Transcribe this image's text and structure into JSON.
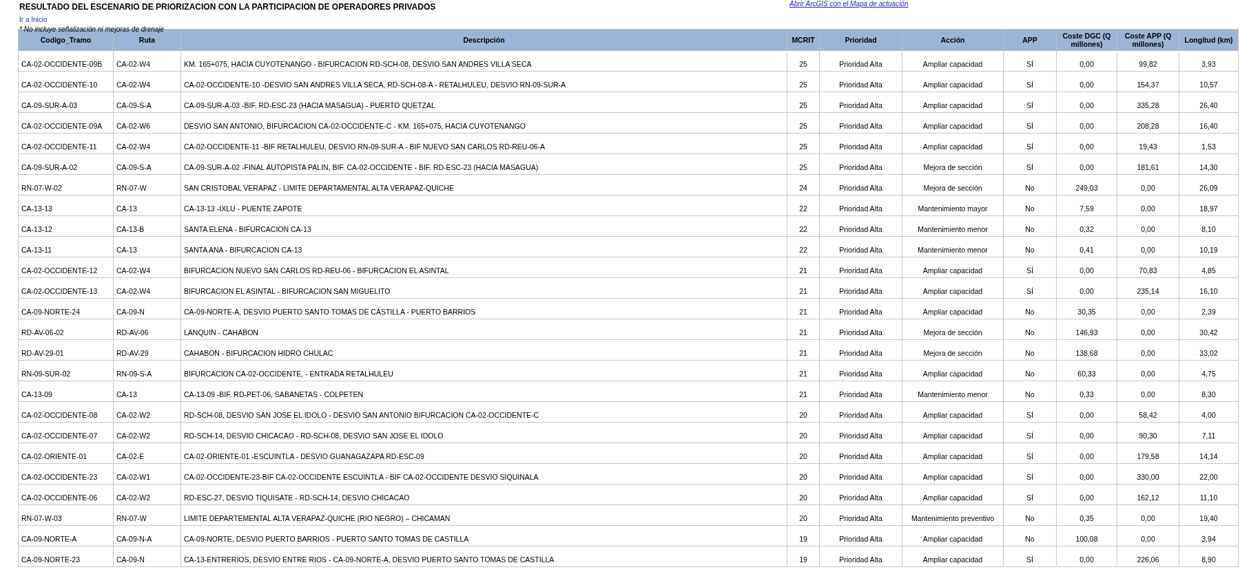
{
  "title": "RESULTADO DEL ESCENARIO DE PRIORIZACION CON LA PARTICIPACION DE OPERADORES PRIVADOS",
  "map_link": "Abrir ArcGIS con el Mapa de actuación",
  "home_link": "Ir a Inicio",
  "note": "* No incluye señalización ni mejoras de drenaje",
  "table": {
    "columns": [
      "Codigo_Tramo",
      "Ruta",
      "Descripción",
      "MCRIT",
      "Prioridad",
      "Acción",
      "APP",
      "Coste DGC (Q millones)",
      "Coste APP (Q millones)",
      "Longitud (km)"
    ],
    "rows": [
      [
        "CA-02-OCCIDENTE-09B",
        "CA-02-W4",
        "KM. 165+075, HACIA CUYOTENANGO - BIFURCACION RD-SCH-08, DESVIO SAN ANDRES VILLA SECA",
        "25",
        "Prioridad Alta",
        "Ampliar capacidad",
        "SÍ",
        "0,00",
        "99,82",
        "3,93"
      ],
      [
        "CA-02-OCCIDENTE-10",
        "CA-02-W4",
        "CA-02-OCCIDENTE-10 -DESVIO SAN ANDRES VILLA SECA, RD-SCH-08-A - RETALHULEU, DESVIO RN-09-SUR-A",
        "25",
        "Prioridad Alta",
        "Ampliar capacidad",
        "SÍ",
        "0,00",
        "154,37",
        "10,57"
      ],
      [
        "CA-09-SUR-A-03",
        "CA-09-S-A",
        "CA-09-SUR-A-03 -BIF. RD-ESC-23 (HACIA MASAGUA) - PUERTO QUETZAL",
        "25",
        "Prioridad Alta",
        "Ampliar capacidad",
        "SÍ",
        "0,00",
        "335,28",
        "26,40"
      ],
      [
        "CA-02-OCCIDENTE-09A",
        "CA-02-W6",
        "DESVIO SAN ANTONIO, BIFURCACION CA-02-OCCIDENTE-C - KM. 165+075, HACIA CUYOTENANGO",
        "25",
        "Prioridad Alta",
        "Ampliar capacidad",
        "SÍ",
        "0,00",
        "208,28",
        "16,40"
      ],
      [
        "CA-02-OCCIDENTE-11",
        "CA-02-W4",
        "CA-02-OCCIDENTE-11 -BIF RETALHULEU, DESVIO RN-09-SUR-A - BIF NUEVO SAN CARLOS RD-REU-06-A",
        "25",
        "Prioridad Alta",
        "Ampliar capacidad",
        "SÍ",
        "0,00",
        "19,43",
        "1,53"
      ],
      [
        "CA-09-SUR-A-02",
        "CA-09-S-A",
        "CA-09-SUR-A-02 -FINAL AUTOPISTA PALIN, BIF. CA-02-OCCIDENTE - BIF. RD-ESC-23 (HACIA MASAGUA)",
        "25",
        "Prioridad Alta",
        "Mejora de sección",
        "SÍ",
        "0,00",
        "181,61",
        "14,30"
      ],
      [
        "RN-07-W-02",
        "RN-07-W",
        "SAN CRISTOBAL VERAPAZ  - LIMITE DEPARTAMENTAL ALTA VERAPAZ-QUICHE",
        "24",
        "Prioridad Alta",
        "Mejora de sección",
        "No",
        "249,03",
        "0,00",
        "26,09"
      ],
      [
        "CA-13-13",
        "CA-13",
        "CA-13-13 -IXLU - PUENTE ZAPOTE",
        "22",
        "Prioridad Alta",
        "Mantenimiento mayor",
        "No",
        "7,59",
        "0,00",
        "18,97"
      ],
      [
        "CA-13-12",
        "CA-13-B",
        "SANTA ELENA - BIFURCACION CA-13",
        "22",
        "Prioridad Alta",
        "Mantenimiento menor",
        "No",
        "0,32",
        "0,00",
        "8,10"
      ],
      [
        "CA-13-11",
        "CA-13",
        "SANTA ANA - BIFURCACION CA-13",
        "22",
        "Prioridad Alta",
        "Mantenimiento menor",
        "No",
        "0,41",
        "0,00",
        "10,19"
      ],
      [
        "CA-02-OCCIDENTE-12",
        "CA-02-W4",
        "BIFURCACION NUEVO SAN CARLOS RD-REU-06 - BIFURCACION EL ASINTAL",
        "21",
        "Prioridad Alta",
        "Ampliar capacidad",
        "SÍ",
        "0,00",
        "70,83",
        "4,85"
      ],
      [
        "CA-02-OCCIDENTE-13",
        "CA-02-W4",
        "BIFURCACION EL ASINTAL - BIFURCACION SAN MIGUELITO",
        "21",
        "Prioridad Alta",
        "Ampliar capacidad",
        "SÍ",
        "0,00",
        "235,14",
        "16,10"
      ],
      [
        "CA-09-NORTE-24",
        "CA-09-N",
        "CA-09-NORTE-A, DESVIO PUERTO SANTO TOMAS DE CASTILLA - PUERTO BARRIOS",
        "21",
        "Prioridad Alta",
        "Ampliar capacidad",
        "No",
        "30,35",
        "0,00",
        "2,39"
      ],
      [
        "RD-AV-06-02",
        "RD-AV-06",
        "LANQUIN - CAHABON",
        "21",
        "Prioridad Alta",
        "Mejora de sección",
        "No",
        "146,93",
        "0,00",
        "30,42"
      ],
      [
        "RD-AV-29-01",
        "RD-AV-29",
        "CAHABON - BIFURCACION HIDRO CHULAC",
        "21",
        "Prioridad Alta",
        "Mejora de sección",
        "No",
        "138,68",
        "0,00",
        "33,02"
      ],
      [
        "RN-09-SUR-02",
        "RN-09-S-A",
        "BIFURCACION CA-02-OCCIDENTE, - ENTRADA RETALHULEU",
        "21",
        "Prioridad Alta",
        "Ampliar capacidad",
        "No",
        "60,33",
        "0,00",
        "4,75"
      ],
      [
        "CA-13-09",
        "CA-13",
        "CA-13-09 -BIF. RD-PET-06, SABANETAS - COLPETEN",
        "21",
        "Prioridad Alta",
        "Mantenimiento menor",
        "No",
        "0,33",
        "0,00",
        "8,30"
      ],
      [
        "CA-02-OCCIDENTE-08",
        "CA-02-W2",
        "RD-SCH-08, DESVIO SAN JOSE EL IDOLO - DESVIO SAN ANTONIO BIFURCACION CA-02-OCCIDENTE-C",
        "20",
        "Prioridad Alta",
        "Ampliar capacidad",
        "SÍ",
        "0,00",
        "58,42",
        "4,00"
      ],
      [
        "CA-02-OCCIDENTE-07",
        "CA-02-W2",
        "RD-SCH-14, DESVIO CHICACAO - RD-SCH-08, DESVIO SAN JOSE EL IDOLO",
        "20",
        "Prioridad Alta",
        "Ampliar capacidad",
        "SÍ",
        "0,00",
        "90,30",
        "7,11"
      ],
      [
        "CA-02-ORIENTE-01",
        "CA-02-E",
        "CA-02-ORIENTE-01 -ESCUINTLA - DESVIO GUANAGAZAPA RD-ESC-09",
        "20",
        "Prioridad Alta",
        "Ampliar capacidad",
        "SÍ",
        "0,00",
        "179,58",
        "14,14"
      ],
      [
        "CA-02-OCCIDENTE-23",
        "CA-02-W1",
        "CA-02-OCCIDENTE-23-BIF CA-02-OCCIDENTE ESCUINTLA -  BIF CA-02-OCCIDENTE DESVIO SIQUINALA",
        "20",
        "Prioridad Alta",
        "Ampliar capacidad",
        "SÍ",
        "0,00",
        "330,00",
        "22,00"
      ],
      [
        "CA-02-OCCIDENTE-06",
        "CA-02-W2",
        "RD-ESC-27, DESVIO TIQUISATE - RD-SCH-14, DESVIO CHICACAO",
        "20",
        "Prioridad Alta",
        "Ampliar capacidad",
        "SÍ",
        "0,00",
        "162,12",
        "11,10"
      ],
      [
        "RN-07-W-03",
        "RN-07-W",
        "LIMITE DEPARTEMENTAL ALTA VERAPAZ-QUICHE (RIO NEGRO) – CHICAMAN",
        "20",
        "Prioridad Alta",
        "Mantenimiento preventivo",
        "No",
        "0,35",
        "0,00",
        "19,40"
      ],
      [
        "CA-09-NORTE-A",
        "CA-09-N-A",
        "CA-09-NORTE, DESVIO PUERTO BARRIOS - PUERTO SANTO TOMAS DE CASTILLA",
        "19",
        "Prioridad Alta",
        "Ampliar capacidad",
        "No",
        "100,08",
        "0,00",
        "3,94"
      ],
      [
        "CA-09-NORTE-23",
        "CA-09-N",
        "CA-13-ENTRERIOS, DESVIO ENTRE RIOS - CA-09-NORTE-A, DESVIO PUERTO SANTO TOMAS DE CASTILLA",
        "19",
        "Prioridad Alta",
        "Ampliar capacidad",
        "SÍ",
        "0,00",
        "226,06",
        "8,90"
      ]
    ]
  }
}
